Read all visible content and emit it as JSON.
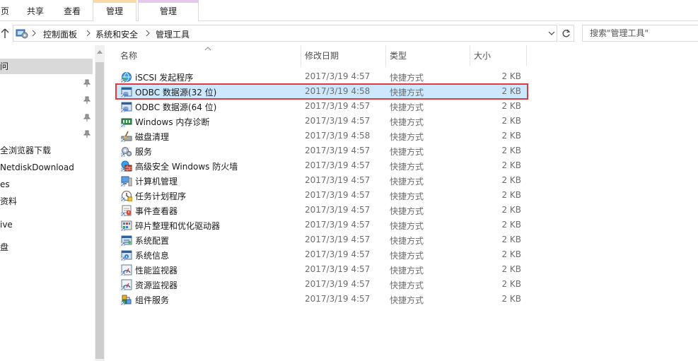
{
  "ribbon": {
    "tabs": [
      "页",
      "共享",
      "查看"
    ],
    "context_tabs": [
      "管理",
      "管理"
    ],
    "context_colors": [
      "#f9d9a8",
      "#e7c9f0"
    ]
  },
  "address": {
    "path": [
      "控制面板",
      "系统和安全",
      "管理工具"
    ],
    "search_placeholder": "搜索\"管理工具\""
  },
  "nav": {
    "items": [
      "问",
      "",
      "",
      "",
      "",
      "全浏览器下载",
      "NetdiskDownload",
      "es",
      "资料",
      "",
      "ive",
      "",
      "盘"
    ]
  },
  "columns": {
    "name": "名称",
    "modified": "修改日期",
    "type": "类型",
    "size": "大小"
  },
  "files": [
    {
      "name": "iSCSI 发起程序",
      "date": "2017/3/19 4:57",
      "type": "快捷方式",
      "size": "2 KB",
      "icon": "globe-icon"
    },
    {
      "name": "ODBC 数据源(32 位)",
      "date": "2017/3/19 4:58",
      "type": "快捷方式",
      "size": "2 KB",
      "icon": "database-icon"
    },
    {
      "name": "ODBC 数据源(64 位)",
      "date": "2017/3/19 4:57",
      "type": "快捷方式",
      "size": "2 KB",
      "icon": "database-icon"
    },
    {
      "name": "Windows 内存诊断",
      "date": "2017/3/19 4:57",
      "type": "快捷方式",
      "size": "2 KB",
      "icon": "memory-icon"
    },
    {
      "name": "磁盘清理",
      "date": "2017/3/19 4:58",
      "type": "快捷方式",
      "size": "2 KB",
      "icon": "disk-cleanup-icon"
    },
    {
      "name": "服务",
      "date": "2017/3/19 4:57",
      "type": "快捷方式",
      "size": "2 KB",
      "icon": "gears-icon"
    },
    {
      "name": "高级安全 Windows 防火墙",
      "date": "2017/3/19 4:57",
      "type": "快捷方式",
      "size": "2 KB",
      "icon": "firewall-icon"
    },
    {
      "name": "计算机管理",
      "date": "2017/3/19 4:57",
      "type": "快捷方式",
      "size": "2 KB",
      "icon": "computer-icon"
    },
    {
      "name": "任务计划程序",
      "date": "2017/3/19 4:57",
      "type": "快捷方式",
      "size": "2 KB",
      "icon": "clock-icon"
    },
    {
      "name": "事件查看器",
      "date": "2017/3/19 4:57",
      "type": "快捷方式",
      "size": "2 KB",
      "icon": "event-icon"
    },
    {
      "name": "碎片整理和优化驱动器",
      "date": "2017/3/19 4:57",
      "type": "快捷方式",
      "size": "2 KB",
      "icon": "defrag-icon"
    },
    {
      "name": "系统配置",
      "date": "2017/3/19 4:57",
      "type": "快捷方式",
      "size": "2 KB",
      "icon": "config-icon"
    },
    {
      "name": "系统信息",
      "date": "2017/3/19 4:57",
      "type": "快捷方式",
      "size": "2 KB",
      "icon": "info-icon"
    },
    {
      "name": "性能监视器",
      "date": "2017/3/19 4:57",
      "type": "快捷方式",
      "size": "2 KB",
      "icon": "gauge-icon"
    },
    {
      "name": "资源监视器",
      "date": "2017/3/19 4:57",
      "type": "快捷方式",
      "size": "2 KB",
      "icon": "gauge-icon"
    },
    {
      "name": "组件服务",
      "date": "2017/3/19 4:57",
      "type": "快捷方式",
      "size": "2 KB",
      "icon": "components-icon"
    }
  ],
  "selected_file": 1,
  "colors": {
    "selection_bg": "#cce8ff",
    "highlight_outline": "#e0393e"
  }
}
